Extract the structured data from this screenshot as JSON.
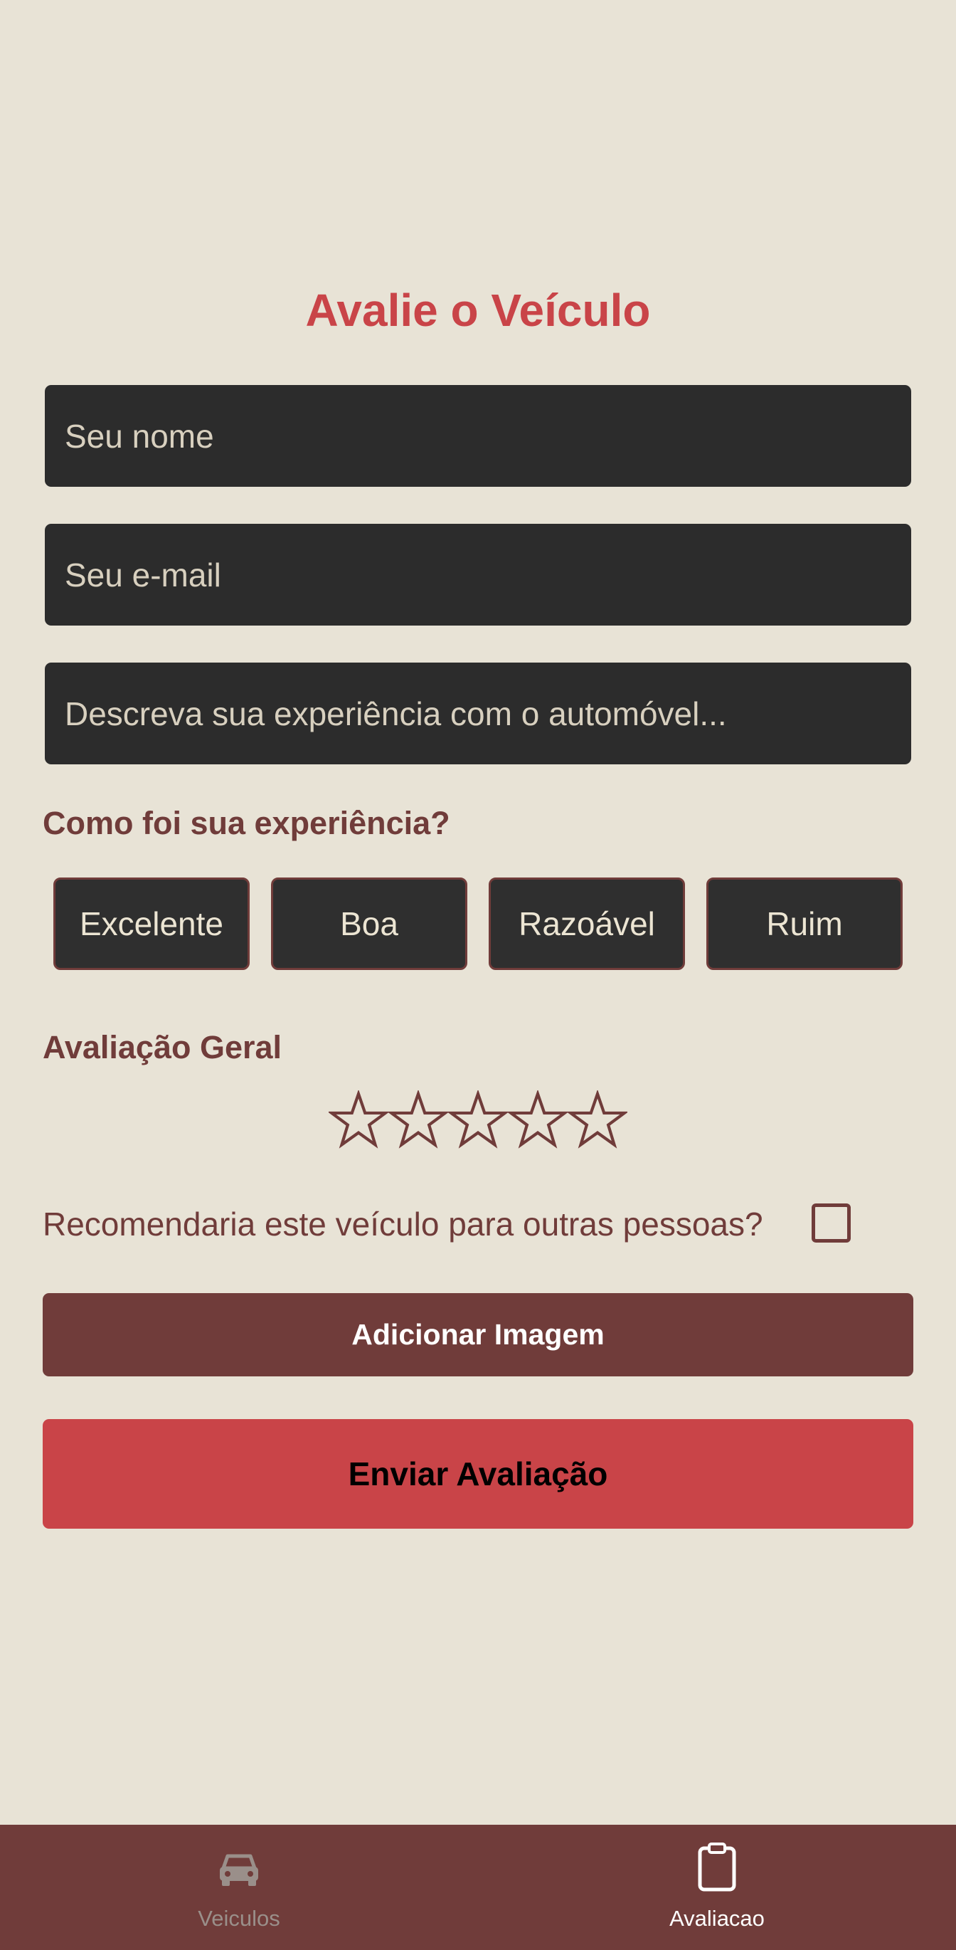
{
  "title": "Avalie o Veículo",
  "form": {
    "name_placeholder": "Seu nome",
    "email_placeholder": "Seu e-mail",
    "description_placeholder": "Descreva sua experiência com o automóvel...",
    "name_value": "",
    "email_value": "",
    "description_value": ""
  },
  "experience": {
    "label": "Como foi sua experiência?",
    "options": [
      "Excelente",
      "Boa",
      "Razoável",
      "Ruim"
    ],
    "selected": null
  },
  "rating": {
    "label": "Avaliação Geral",
    "max": 5,
    "value": 0
  },
  "recommend": {
    "label": "Recomendaria este veículo para outras pessoas?",
    "checked": false
  },
  "buttons": {
    "add_image": "Adicionar Imagem",
    "submit": "Enviar Avaliação"
  },
  "tabs": [
    {
      "label": "Veiculos",
      "icon": "car-icon",
      "active": false
    },
    {
      "label": "Avaliacao",
      "icon": "clipboard-icon",
      "active": true
    }
  ],
  "colors": {
    "background": "#e8e3d6",
    "accent": "#c94448",
    "brand": "#703c3a",
    "field_bg": "#2c2c2c"
  }
}
